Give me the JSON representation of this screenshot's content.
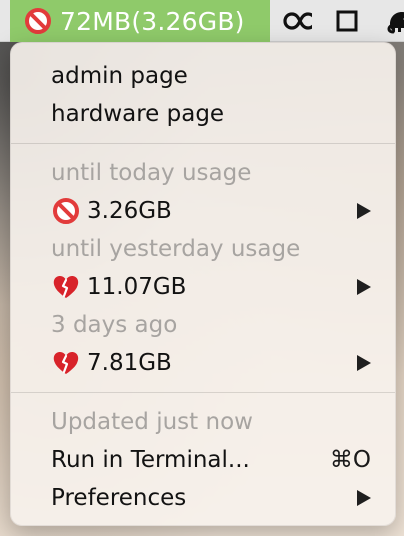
{
  "menubar": {
    "status_text": "72MB(3.26GB)",
    "status_color": "#8fca6a",
    "icons": [
      "infinity-icon",
      "square-icon",
      "elephant-icon"
    ]
  },
  "menu": {
    "admin_page": "admin page",
    "hardware_page": "hardware page",
    "until_today_label": "until today usage",
    "until_today_value": "3.26GB",
    "until_yesterday_label": "until yesterday usage",
    "until_yesterday_value": "11.07GB",
    "three_days_label": "3 days ago",
    "three_days_value": "7.81GB",
    "updated_status": "Updated just now",
    "run_in_terminal": "Run in Terminal...",
    "run_in_terminal_shortcut": "⌘O",
    "preferences": "Preferences"
  }
}
